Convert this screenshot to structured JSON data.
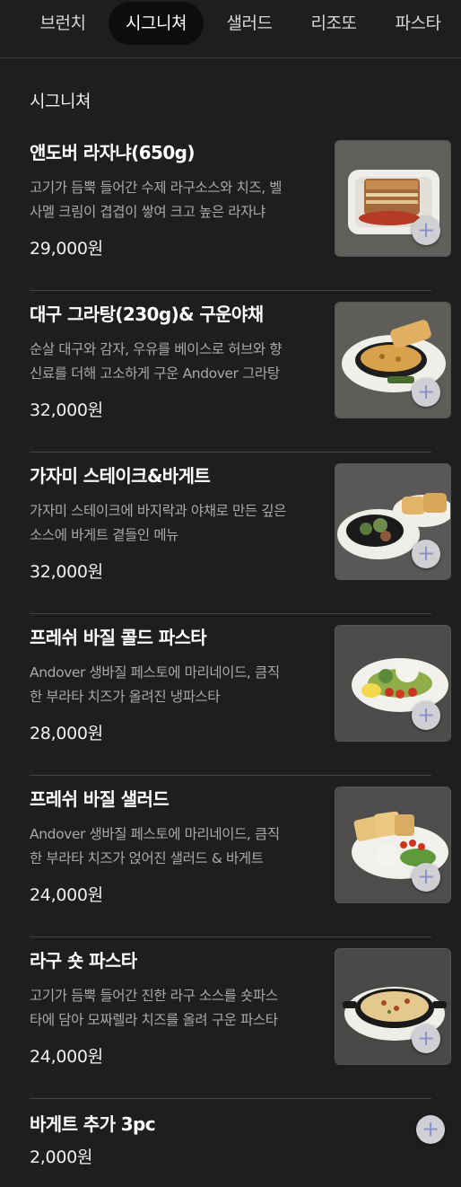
{
  "tabs": [
    {
      "label": "브런치",
      "active": false
    },
    {
      "label": "시그니쳐",
      "active": true
    },
    {
      "label": "샐러드",
      "active": false
    },
    {
      "label": "리조또",
      "active": false
    },
    {
      "label": "파스타",
      "active": false
    }
  ],
  "section": {
    "title": "시그니쳐"
  },
  "add_icon": "+",
  "items": [
    {
      "name": "앤도버 라자냐(650g)",
      "desc_line1": "고기가 듬뿍 들어간 수제 라구소스와 치즈, 벨",
      "desc_line2": "사멜 크림이 겹겹이 쌓여 크고 높은 라자냐",
      "price": "29,000원",
      "image": "lasagna-photo"
    },
    {
      "name": "대구 그라탕(230g)& 구운야채",
      "desc_line1": "순살 대구와 감자, 우유를 베이스로 허브와 향",
      "desc_line2": "신료를 더해 고소하게 구운 Andover 그라탕",
      "price": "32,000원",
      "image": "cod-gratin-photo"
    },
    {
      "name": "가자미 스테이크&바게트",
      "desc_line1": "가자미 스테이크에 바지락과 야채로 만든 깊은",
      "desc_line2": "소스에 바게트 곁들인 메뉴",
      "price": "32,000원",
      "image": "flounder-steak-photo"
    },
    {
      "name": "프레쉬 바질 콜드 파스타",
      "desc_line1": "Andover 생바질 페스토에 마리네이드, 큼직",
      "desc_line2": "한 부라타 치즈가 올려진 냉파스타",
      "price": "28,000원",
      "image": "basil-cold-pasta-photo"
    },
    {
      "name": "프레쉬 바질 샐러드",
      "desc_line1": "Andover 생바질 페스토에 마리네이드, 큼직",
      "desc_line2": "한 부라타 치즈가 얹어진 샐러드 & 바게트",
      "price": "24,000원",
      "image": "basil-salad-photo"
    },
    {
      "name": "라구 숏 파스타",
      "desc_line1": "고기가 듬뿍 들어간 진한 라구 소스를 숏파스",
      "desc_line2": "타에 담아 모짜렐라 치즈를 올려 구운 파스타",
      "price": "24,000원",
      "image": "ragu-short-pasta-photo"
    }
  ],
  "extra_item": {
    "name": "바게트 추가 3pc",
    "price": "2,000원"
  },
  "colors": {
    "background": "#1e1e1e",
    "active_tab": "#0d0d0d",
    "add_button": "#d0d0d4",
    "add_icon": "#8a92c8"
  }
}
